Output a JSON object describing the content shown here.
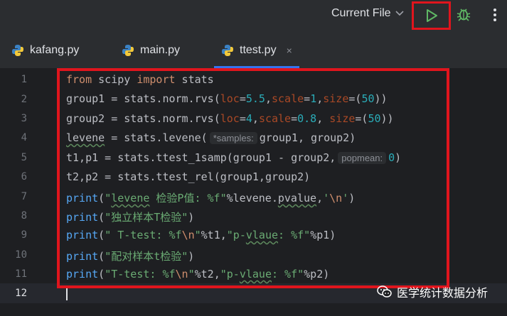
{
  "toolbar": {
    "run_config_label": "Current File",
    "icons": {
      "chevron": "chevron-down-icon",
      "run": "play-icon",
      "debug": "bug-icon",
      "more": "vertical-dots-icon"
    },
    "run_color": "#5fb865",
    "highlight_color": "#e0151d"
  },
  "tabs": [
    {
      "label": "kafang.py",
      "icon": "python-icon",
      "active": false
    },
    {
      "label": "main.py",
      "icon": "python-icon",
      "active": false
    },
    {
      "label": "ttest.py",
      "icon": "python-icon",
      "active": true,
      "close": "×"
    }
  ],
  "editor": {
    "line_numbers": [
      "1",
      "2",
      "3",
      "4",
      "5",
      "6",
      "7",
      "8",
      "9",
      "10",
      "11",
      "12"
    ],
    "current_line": "12",
    "lines": [
      "from scipy import stats",
      "group1 = stats.norm.rvs(loc=5.5, scale=1, size=(50))",
      "group2 = stats.norm.rvs(loc=4, scale=0.8, size=(50))",
      "levene = stats.levene(*samples: group1, group2)",
      "t1, p1 = stats.ttest_1samp(group1 - group2, popmean: 0)",
      "t2, p2 = stats.ttest_rel(group1, group2)",
      "print(\"levene 检验P值: %f\"%levene.pvalue, '\\n')",
      "print(\"独立样本T检验\")",
      "print(\" T-test: %f\\n\"%t1, \"p-vlaue: %f\"%p1)",
      "print(\"配对样本t检验\")",
      "print(\"T-test: %f\\n\"%t2, \"p-vlaue: %f\"%p2)",
      ""
    ],
    "hints": {
      "samples": "*samples:",
      "popmean": "popmean:"
    }
  },
  "watermark": {
    "text": "医学统计数据分析",
    "icon": "wechat-icon"
  }
}
